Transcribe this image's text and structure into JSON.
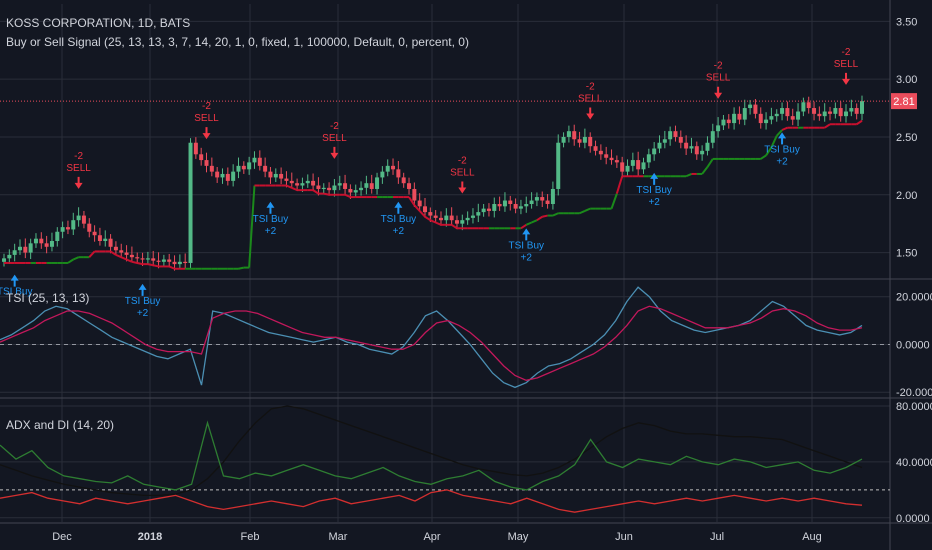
{
  "header": {
    "symbol_line": "KOSS CORPORATION, 1D, BATS",
    "strategy_line": "Buy or Sell Signal (25, 13, 13, 3, 7, 14, 20, 1, 0, fixed, 1, 100000, Default, 0, percent, 0)"
  },
  "panes": {
    "tsi_title": "TSI (25, 13, 13)",
    "adx_title": "ADX and DI (14, 20)"
  },
  "colors": {
    "background": "#131722",
    "grid": "#2a2e39",
    "up": "#53b987",
    "down": "#eb4d5c",
    "buy_label": "#2196f3",
    "sell_label": "#f23645",
    "trail_green": "#1b8a1b",
    "trail_red": "#c8102e",
    "tsi_line": "#4b8fb3",
    "tsi_signal": "#c2185b",
    "adx_line": "#111111",
    "di_plus": "#2e7d32",
    "di_minus": "#d32f2f",
    "last_price_bg": "#eb4d5c"
  },
  "chart_data": [
    {
      "type": "candlestick",
      "title": "KOSS CORPORATION, 1D, BATS",
      "ylim": [
        1.28,
        3.65
      ],
      "y_ticks": [
        "3.50",
        "3.00",
        "2.50",
        "2.00",
        "1.50"
      ],
      "last_price": "2.81",
      "x_ticks": [
        "Dec",
        "2018",
        "Feb",
        "Mar",
        "Apr",
        "May",
        "Jun",
        "Jul",
        "Aug"
      ],
      "series": [
        {
          "name": "price",
          "values": [
            1.45,
            1.48,
            1.52,
            1.55,
            1.5,
            1.58,
            1.62,
            1.58,
            1.55,
            1.6,
            1.68,
            1.72,
            1.7,
            1.78,
            1.82,
            1.75,
            1.68,
            1.65,
            1.6,
            1.62,
            1.55,
            1.52,
            1.5,
            1.48,
            1.46,
            1.45,
            1.44,
            1.45,
            1.43,
            1.42,
            1.44,
            1.42,
            1.4,
            1.42,
            1.41,
            2.45,
            2.35,
            2.3,
            2.25,
            2.2,
            2.15,
            2.18,
            2.12,
            2.2,
            2.25,
            2.22,
            2.28,
            2.32,
            2.25,
            2.2,
            2.15,
            2.18,
            2.14,
            2.12,
            2.1,
            2.08,
            2.1,
            2.12,
            2.08,
            2.05,
            2.06,
            2.04,
            2.08,
            2.1,
            2.05,
            2.02,
            2.04,
            2.06,
            2.1,
            2.05,
            2.15,
            2.2,
            2.25,
            2.22,
            2.15,
            2.1,
            2.05,
            1.95,
            1.9,
            1.85,
            1.82,
            1.8,
            1.78,
            1.82,
            1.78,
            1.75,
            1.78,
            1.8,
            1.82,
            1.85,
            1.88,
            1.86,
            1.92,
            1.9,
            1.95,
            1.92,
            1.88,
            1.9,
            1.92,
            1.95,
            1.98,
            1.95,
            1.92,
            2.05,
            2.45,
            2.5,
            2.55,
            2.48,
            2.45,
            2.5,
            2.42,
            2.38,
            2.35,
            2.32,
            2.3,
            2.28,
            2.2,
            2.25,
            2.3,
            2.22,
            2.28,
            2.35,
            2.4,
            2.45,
            2.48,
            2.55,
            2.5,
            2.45,
            2.4,
            2.42,
            2.35,
            2.38,
            2.45,
            2.55,
            2.6,
            2.65,
            2.62,
            2.7,
            2.65,
            2.75,
            2.78,
            2.7,
            2.62,
            2.65,
            2.68,
            2.7,
            2.75,
            2.68,
            2.65,
            2.72,
            2.8,
            2.75,
            2.7,
            2.68,
            2.72,
            2.7,
            2.75,
            2.68,
            2.72,
            2.75,
            2.7,
            2.81
          ]
        }
      ],
      "annotations": [
        {
          "type": "TSI Buy",
          "label": "TSI Buy"
        },
        {
          "type": "SELL",
          "label": "SELL",
          "value": "-2"
        },
        {
          "type": "TSI Buy",
          "label": "TSI Buy",
          "value": "+2"
        },
        {
          "type": "SELL",
          "label": "SELL",
          "value": "-2"
        },
        {
          "type": "TSI Buy",
          "label": "TSI Buy",
          "value": "+2"
        },
        {
          "type": "SELL",
          "label": "SELL",
          "value": "-2"
        },
        {
          "type": "TSI Buy",
          "label": "TSI Buy",
          "value": "+2"
        },
        {
          "type": "SELL",
          "label": "SELL",
          "value": "-2"
        },
        {
          "type": "TSI Buy",
          "label": "TSI Buy",
          "value": "+2"
        },
        {
          "type": "SELL",
          "label": "SELL",
          "value": "-2"
        },
        {
          "type": "TSI Buy",
          "label": "TSI Buy",
          "value": "+2"
        },
        {
          "type": "SELL",
          "label": "SELL",
          "value": "-2"
        },
        {
          "type": "TSI Buy",
          "label": "TSI Buy",
          "value": "+2"
        },
        {
          "type": "SELL",
          "label": "SELL",
          "value": "-2"
        }
      ]
    },
    {
      "type": "line",
      "title": "TSI (25, 13, 13)",
      "ylim": [
        -22,
        27
      ],
      "y_ticks": [
        "20.0000",
        "0.0000",
        "-20.0000"
      ],
      "series": [
        {
          "values": [
            2,
            4,
            7,
            10,
            14,
            16,
            15,
            12,
            9,
            6,
            3,
            1,
            -1,
            -3,
            -5,
            -6,
            -4,
            -2,
            -17,
            14,
            13,
            11,
            9,
            7,
            5,
            4,
            3,
            2,
            1,
            2,
            3,
            1,
            0,
            -2,
            -3,
            -4,
            -1,
            5,
            12,
            14,
            10,
            5,
            0,
            -6,
            -12,
            -16,
            -18,
            -16,
            -12,
            -9,
            -8,
            -6,
            -3,
            0,
            4,
            10,
            18,
            24,
            20,
            14,
            10,
            8,
            6,
            5,
            6,
            7,
            8,
            10,
            14,
            18,
            16,
            12,
            8,
            6,
            5,
            4,
            5,
            8
          ]
        },
        {
          "values": [
            1,
            3,
            5,
            7,
            10,
            12,
            14,
            14,
            13,
            11,
            9,
            6,
            3,
            0,
            -2,
            -3,
            -3,
            -3,
            -4,
            11,
            13,
            14,
            14,
            13,
            11,
            9,
            7,
            5,
            4,
            3,
            3,
            2,
            1,
            0,
            -1,
            -2,
            -2,
            0,
            5,
            9,
            10,
            8,
            5,
            1,
            -4,
            -9,
            -13,
            -15,
            -14,
            -12,
            -10,
            -8,
            -6,
            -4,
            -1,
            3,
            8,
            14,
            16,
            15,
            13,
            11,
            9,
            7,
            7,
            7,
            8,
            9,
            11,
            14,
            15,
            14,
            12,
            9,
            7,
            6,
            6,
            7
          ]
        }
      ]
    },
    {
      "type": "line",
      "title": "ADX and DI (14, 20)",
      "ylim": [
        -3,
        85
      ],
      "y_ticks": [
        "80.0000",
        "40.0000",
        "0.0000"
      ],
      "threshold": 20,
      "series": [
        {
          "values": [
            38,
            34,
            30,
            27,
            24,
            22,
            20,
            18,
            17,
            16,
            16,
            17,
            20,
            28,
            40,
            55,
            68,
            78,
            80,
            78,
            74,
            70,
            66,
            62,
            58,
            54,
            50,
            46,
            42,
            38,
            35,
            33,
            31,
            30,
            32,
            36,
            42,
            50,
            58,
            64,
            68,
            66,
            62,
            60,
            60,
            59,
            58,
            58,
            57,
            56,
            52,
            48,
            44,
            40,
            36
          ]
        },
        {
          "values": [
            52,
            42,
            48,
            36,
            30,
            28,
            26,
            25,
            30,
            24,
            22,
            20,
            24,
            68,
            30,
            28,
            32,
            30,
            34,
            38,
            34,
            30,
            28,
            32,
            36,
            30,
            26,
            24,
            28,
            30,
            34,
            26,
            22,
            20,
            26,
            30,
            38,
            56,
            40,
            36,
            42,
            40,
            38,
            44,
            40,
            38,
            42,
            40,
            36,
            38,
            40,
            34,
            32,
            36,
            42
          ]
        },
        {
          "values": [
            14,
            16,
            18,
            14,
            12,
            10,
            14,
            12,
            10,
            12,
            14,
            16,
            12,
            8,
            6,
            8,
            10,
            12,
            10,
            8,
            12,
            14,
            10,
            12,
            14,
            16,
            12,
            18,
            20,
            16,
            14,
            12,
            10,
            14,
            10,
            6,
            4,
            6,
            8,
            10,
            12,
            10,
            12,
            14,
            12,
            14,
            16,
            14,
            12,
            14,
            12,
            14,
            12,
            10,
            9
          ]
        }
      ]
    }
  ]
}
